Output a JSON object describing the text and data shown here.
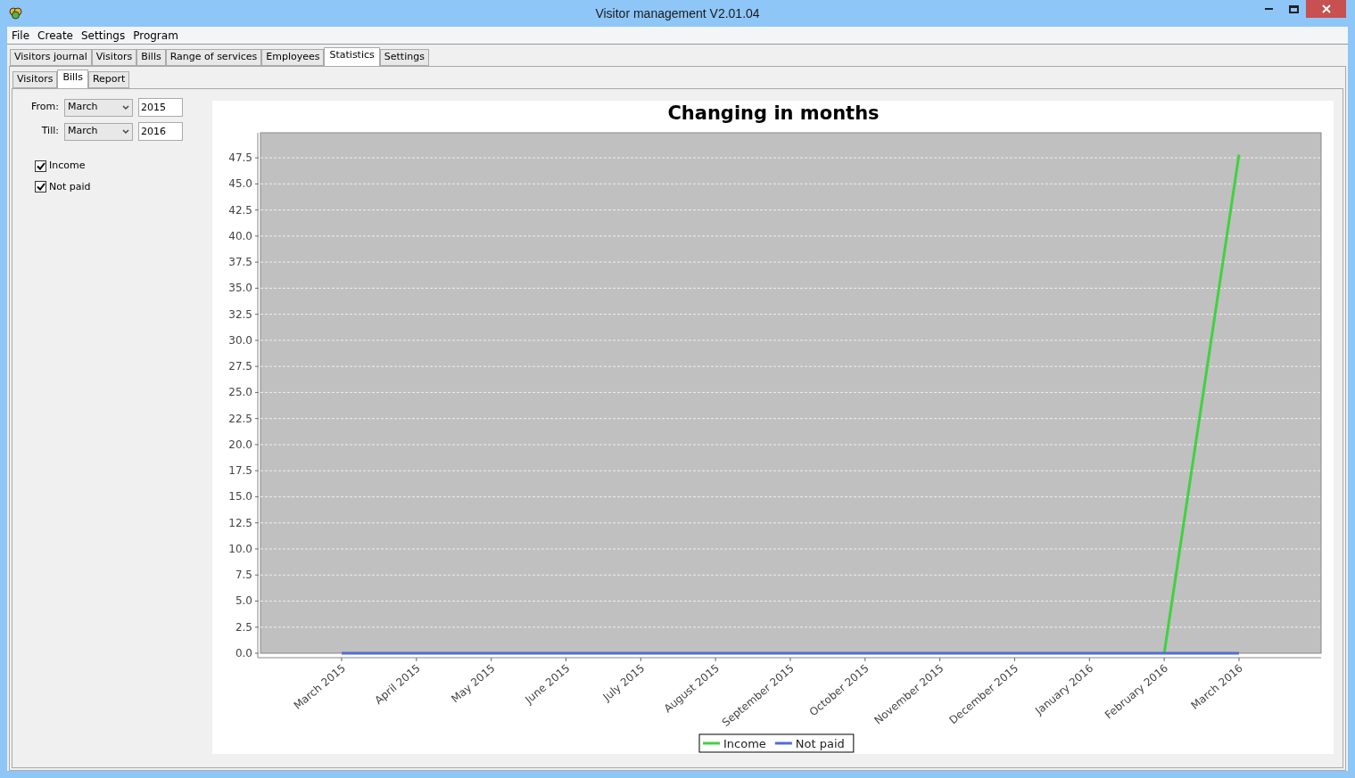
{
  "window": {
    "title": "Visitor management V2.01.04"
  },
  "menu": [
    "File",
    "Create",
    "Settings",
    "Program"
  ],
  "tabs": [
    {
      "label": "Visitors journal",
      "selected": false
    },
    {
      "label": "Visitors",
      "selected": false
    },
    {
      "label": "Bills",
      "selected": false
    },
    {
      "label": "Range of services",
      "selected": false
    },
    {
      "label": "Employees",
      "selected": false
    },
    {
      "label": "Statistics",
      "selected": true
    },
    {
      "label": "Settings",
      "selected": false
    }
  ],
  "subtabs": [
    {
      "label": "Visitors",
      "selected": false
    },
    {
      "label": "Bills",
      "selected": true
    },
    {
      "label": "Report",
      "selected": false
    }
  ],
  "filters": [
    {
      "label": "From:",
      "month": "March",
      "year": "2015"
    },
    {
      "label": "Till:",
      "month": "March",
      "year": "2016"
    }
  ],
  "checkboxes": [
    {
      "label": "Income",
      "checked": true
    },
    {
      "label": "Not paid",
      "checked": true
    }
  ],
  "chart_data": {
    "type": "line",
    "title": "Changing in months",
    "categories": [
      "March 2015",
      "April 2015",
      "May 2015",
      "June 2015",
      "July 2015",
      "August 2015",
      "September 2015",
      "October 2015",
      "November 2015",
      "December 2015",
      "January 2016",
      "February 2016",
      "March 2016"
    ],
    "series": [
      {
        "name": "Income",
        "color": "#3fd23f",
        "values": [
          null,
          null,
          null,
          null,
          null,
          null,
          null,
          null,
          null,
          null,
          null,
          0,
          47.8
        ]
      },
      {
        "name": "Not paid",
        "color": "#4f6fd0",
        "values": [
          0,
          0,
          0,
          0,
          0,
          0,
          0,
          0,
          0,
          0,
          0,
          0,
          0
        ]
      }
    ],
    "ylim": [
      0,
      49.9
    ],
    "grid": true,
    "legend": true,
    "yticks": [
      {
        "value": 0,
        "label": "0.0"
      },
      {
        "value": 2.5,
        "label": "2.5"
      },
      {
        "value": 5,
        "label": "5.0"
      },
      {
        "value": 7.5,
        "label": "7.5"
      },
      {
        "value": 10,
        "label": "10.0"
      },
      {
        "value": 12.5,
        "label": "12.5"
      },
      {
        "value": 15,
        "label": "15.0"
      },
      {
        "value": 17.5,
        "label": "17.5"
      },
      {
        "value": 20,
        "label": "20.0"
      },
      {
        "value": 22.5,
        "label": "22.5"
      },
      {
        "value": 25,
        "label": "25.0"
      },
      {
        "value": 27.5,
        "label": "27.5"
      },
      {
        "value": 30,
        "label": "30.0"
      },
      {
        "value": 32.5,
        "label": "32.5"
      },
      {
        "value": 35,
        "label": "35.0"
      },
      {
        "value": 37.5,
        "label": "37.5"
      },
      {
        "value": 40,
        "label": "40.0"
      },
      {
        "value": 42.5,
        "label": "42.5"
      },
      {
        "value": 45,
        "label": "45.0"
      },
      {
        "value": 47.5,
        "label": "47.5"
      }
    ]
  }
}
